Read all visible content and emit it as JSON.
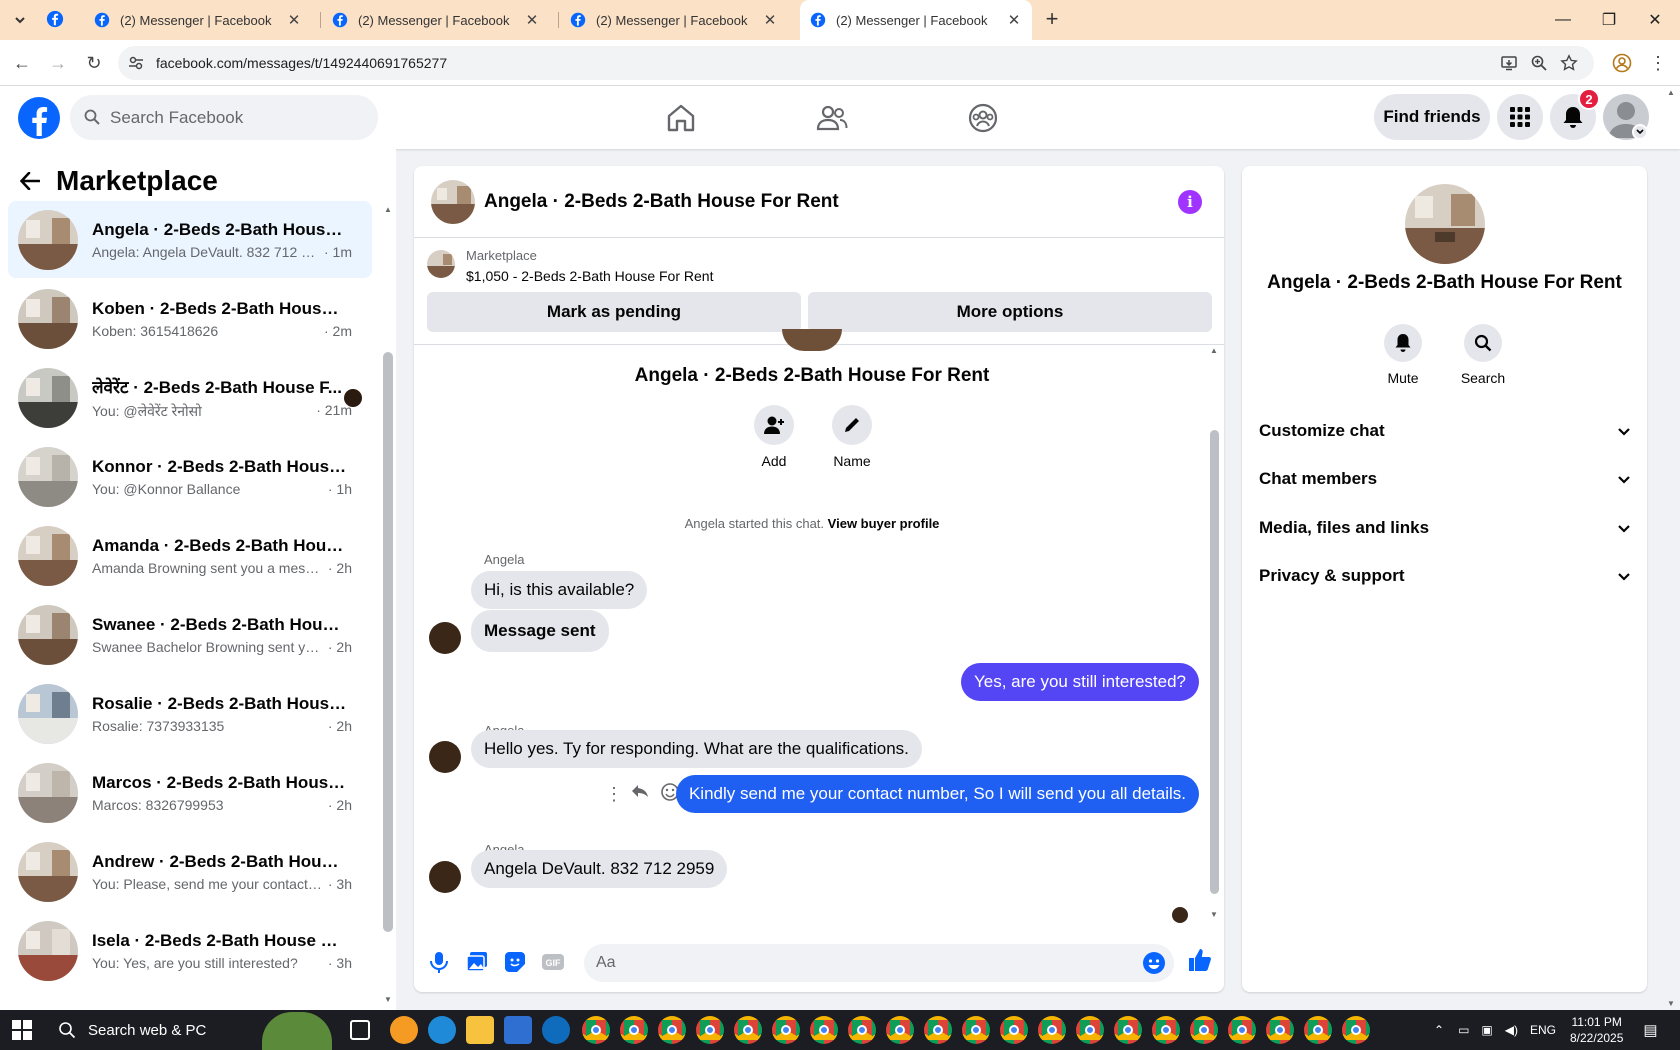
{
  "browser": {
    "tabs": [
      {
        "title": "(2) Messenger | Facebook"
      },
      {
        "title": "(2) Messenger | Facebook"
      },
      {
        "title": "(2) Messenger | Facebook"
      },
      {
        "title": "(2) Messenger | Facebook"
      }
    ],
    "url": "facebook.com/messages/t/1492440691765277"
  },
  "fb": {
    "search_placeholder": "Search Facebook",
    "find_friends": "Find friends",
    "notification_count": "2"
  },
  "sidebar": {
    "title": "Marketplace",
    "conversations": [
      {
        "name": "Angela · 2-Beds 2-Bath House F...",
        "preview": "Angela: Angela DeVault. 832 712 2...",
        "time": "· 1m"
      },
      {
        "name": "Koben · 2-Beds 2-Bath House Fo...",
        "preview": "Koben: 3615418626",
        "time": "· 2m"
      },
      {
        "name": "लेवेरेंट · 2-Beds 2-Bath House F...",
        "preview": "You: @लेवेरेंट रेनोसो",
        "time": "· 21m"
      },
      {
        "name": "Konnor · 2-Beds 2-Bath House F...",
        "preview": "You: @Konnor Ballance",
        "time": "· 1h"
      },
      {
        "name": "Amanda · 2-Beds 2-Bath House ...",
        "preview": "Amanda Browning sent you a mess...",
        "time": "· 2h"
      },
      {
        "name": "Swanee · 2-Beds 2-Bath House F...",
        "preview": "Swanee Bachelor Browning sent yo...",
        "time": "· 2h"
      },
      {
        "name": "Rosalie · 2-Beds 2-Bath House F...",
        "preview": "Rosalie: 7373933135",
        "time": "· 2h"
      },
      {
        "name": "Marcos · 2-Beds 2-Bath House F...",
        "preview": "Marcos: 8326799953",
        "time": "· 2h"
      },
      {
        "name": "Andrew · 2-Beds 2-Bath House F...",
        "preview": "You: Please, send me your contact n...",
        "time": "· 3h"
      },
      {
        "name": "Isela · 2-Beds 2-Bath House For ...",
        "preview": "You: Yes, are you still interested?",
        "time": "· 3h"
      }
    ]
  },
  "chat": {
    "title": "Angela · 2-Beds 2-Bath House For Rent",
    "marketplace_label": "Marketplace",
    "listing": "$1,050 - 2-Beds 2-Bath House For Rent",
    "mark_pending": "Mark as pending",
    "more_options": "More options",
    "intro_title": "Angela · 2-Beds 2-Bath House For Rent",
    "add_label": "Add",
    "name_label": "Name",
    "started": "Angela started this chat.",
    "view_buyer": "View buyer profile",
    "sender": "Angela",
    "messages": [
      {
        "from": "Angela",
        "text": "Hi, is this available?"
      },
      {
        "from": "Angela",
        "text": "Message sent"
      },
      {
        "from": "me",
        "text": "Yes, are you still interested?"
      },
      {
        "from": "Angela",
        "text": "Hello yes. Ty for responding. What are the qualifications."
      },
      {
        "from": "me",
        "text": "Kindly send me your contact number, So I will send you all details."
      },
      {
        "from": "Angela",
        "text": "Angela DeVault. 832 712 2959"
      }
    ],
    "input_placeholder": "Aa"
  },
  "details": {
    "name": "Angela · 2-Beds 2-Bath House For Rent",
    "mute": "Mute",
    "search": "Search",
    "sections": [
      "Customize chat",
      "Chat members",
      "Media, files and links",
      "Privacy & support"
    ]
  },
  "taskbar": {
    "search": "Search web & PC",
    "lang": "ENG",
    "time": "11:01 PM",
    "date": "8/22/2025"
  },
  "colors": {
    "fb_blue": "#0866ff",
    "outgoing_1": "#5445f5",
    "outgoing_2": "#1f5ff2",
    "accent_purple": "#a033ff"
  }
}
